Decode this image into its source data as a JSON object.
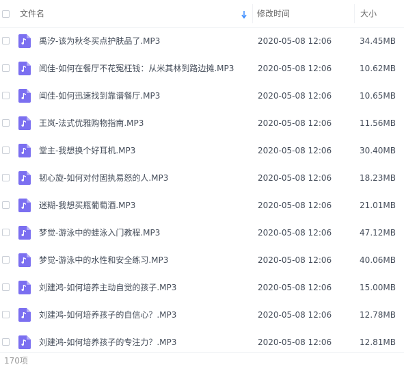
{
  "header": {
    "name_label": "文件名",
    "time_label": "修改时间",
    "size_label": "大小",
    "sort_icon": "sort-down-arrow-icon"
  },
  "colors": {
    "file_icon_bg": "#7b6ff0",
    "sort_arrow": "#3b8cff"
  },
  "files": [
    {
      "name": "禹汐-该为秋冬买点护肤品了.MP3",
      "time": "2020-05-08 12:06",
      "size": "34.45MB",
      "icon": "audio-file-icon"
    },
    {
      "name": "闻佳-如何在餐厅不花冤枉钱：从米其林到路边摊.MP3",
      "time": "2020-05-08 12:06",
      "size": "10.62MB",
      "icon": "audio-file-icon"
    },
    {
      "name": "闻佳-如何迅速找到靠谱餐厅.MP3",
      "time": "2020-05-08 12:06",
      "size": "10.65MB",
      "icon": "audio-file-icon"
    },
    {
      "name": "王岚-法式优雅购物指南.MP3",
      "time": "2020-05-08 12:06",
      "size": "11.56MB",
      "icon": "audio-file-icon"
    },
    {
      "name": "堂主-我想换个好耳机.MP3",
      "time": "2020-05-08 12:06",
      "size": "30.40MB",
      "icon": "audio-file-icon"
    },
    {
      "name": "韧心旋-如何对付固执易怒的人.MP3",
      "time": "2020-05-08 12:06",
      "size": "18.23MB",
      "icon": "audio-file-icon"
    },
    {
      "name": "迷糊-我想买瓶葡萄酒.MP3",
      "time": "2020-05-08 12:06",
      "size": "21.01MB",
      "icon": "audio-file-icon"
    },
    {
      "name": "梦觉-游泳中的蛙泳入门教程.MP3",
      "time": "2020-05-08 12:06",
      "size": "47.12MB",
      "icon": "audio-file-icon"
    },
    {
      "name": "梦觉-游泳中的水性和安全练习.MP3",
      "time": "2020-05-08 12:06",
      "size": "40.06MB",
      "icon": "audio-file-icon"
    },
    {
      "name": "刘建鸿-如何培养主动自觉的孩子.MP3",
      "time": "2020-05-08 12:06",
      "size": "15.00MB",
      "icon": "audio-file-icon"
    },
    {
      "name": "刘建鸿-如何培养孩子的自信心？.MP3",
      "time": "2020-05-08 12:06",
      "size": "12.78MB",
      "icon": "audio-file-icon"
    },
    {
      "name": "刘建鸿-如何培养孩子的专注力？.MP3",
      "time": "2020-05-08 12:06",
      "size": "12.81MB",
      "icon": "audio-file-icon"
    }
  ],
  "footer": {
    "count_label": "170项"
  }
}
